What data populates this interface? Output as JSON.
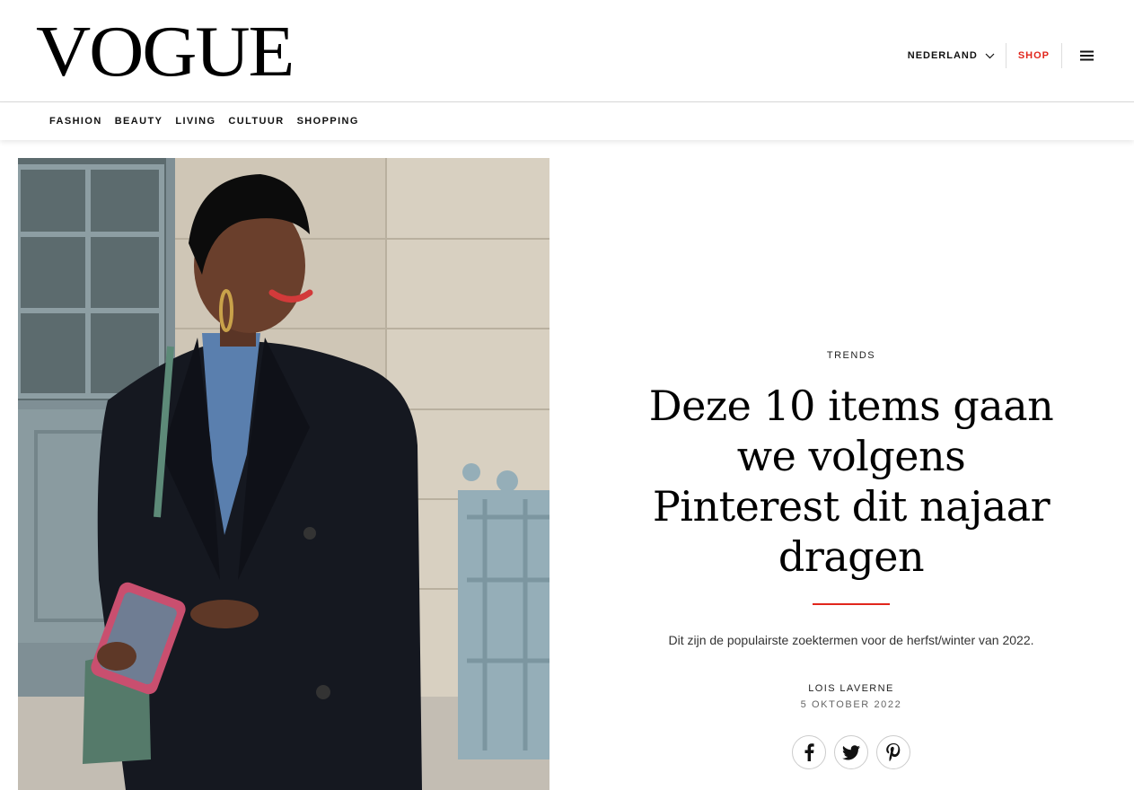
{
  "header": {
    "logo": "VOGUE",
    "region": "NEDERLAND",
    "shop": "SHOP"
  },
  "nav": {
    "items": [
      "FASHION",
      "BEAUTY",
      "LIVING",
      "CULTUUR",
      "SHOPPING"
    ]
  },
  "article": {
    "rubric": "TRENDS",
    "headline_lines": [
      "Deze 10 items gaan",
      "we volgens",
      "Pinterest dit najaar",
      "dragen"
    ],
    "dek": "Dit zijn de populairste zoektermen voor de herfst/winter van 2022.",
    "author": "LOIS LAVERNE",
    "date": "5 OKTOBER 2022",
    "share_icons": [
      "facebook-icon",
      "twitter-icon",
      "pinterest-icon"
    ]
  },
  "colors": {
    "accent_red": "#e1261c",
    "text": "#111111",
    "divider": "#d8d8d8"
  }
}
